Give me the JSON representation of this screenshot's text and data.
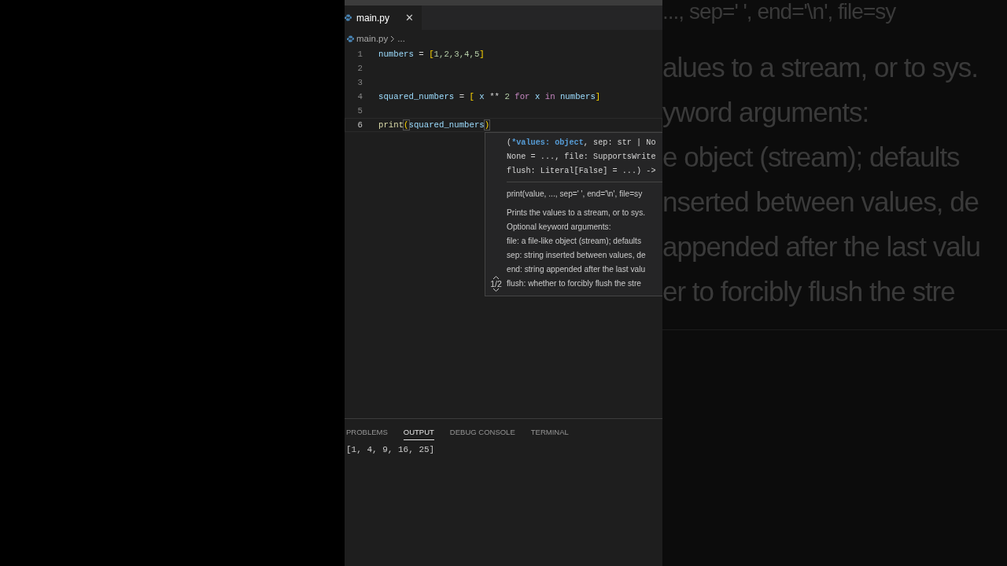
{
  "editor": {
    "tabs": [
      {
        "label": "main.py",
        "selected": true,
        "close": "✕"
      }
    ],
    "breadcrumb": {
      "file": "main.py",
      "rest": "..."
    },
    "lines": [
      {
        "number": "1",
        "current": false,
        "tokens": [
          {
            "kind": "var",
            "text": "numbers"
          },
          {
            "kind": "op",
            "text": " = "
          },
          {
            "kind": "bracket",
            "text": "["
          },
          {
            "kind": "num",
            "text": "1,2,3,4,5"
          },
          {
            "kind": "bracket",
            "text": "]"
          }
        ]
      },
      {
        "number": "2",
        "current": false
      },
      {
        "number": "3",
        "current": false
      },
      {
        "number": "4",
        "current": false,
        "tokens": [
          {
            "kind": "var",
            "text": "squared_numbers"
          },
          {
            "kind": "op",
            "text": " = "
          },
          {
            "kind": "bracket",
            "text": "["
          },
          {
            "kind": "var",
            "text": " x "
          },
          {
            "kind": "op",
            "text": "** "
          },
          {
            "kind": "num",
            "text": "2 "
          },
          {
            "kind": "keyword",
            "text": "for"
          },
          {
            "kind": "var",
            "text": " x "
          },
          {
            "kind": "keyword",
            "text": "in"
          },
          {
            "kind": "var",
            "text": " numbers"
          },
          {
            "kind": "bracket",
            "text": "]"
          }
        ]
      },
      {
        "number": "5",
        "current": false
      },
      {
        "number": "6",
        "current": true,
        "tokens": [
          {
            "kind": "func",
            "text": "print"
          },
          {
            "kind": "paren",
            "text": "("
          },
          {
            "kind": "var",
            "text": "squared_numbers"
          },
          {
            "kind": "paren",
            "text": ")"
          }
        ]
      }
    ]
  },
  "hover": {
    "signature": [
      [
        {
          "kind": "plain",
          "text": "("
        },
        {
          "kind": "param",
          "text": "*values: object"
        },
        {
          "kind": "plain",
          "text": ", sep: str | No"
        }
      ],
      [
        {
          "kind": "plain",
          "text": "None = ..., file: SupportsWrite"
        }
      ],
      [
        {
          "kind": "plain",
          "text": "flush: Literal[False] = ...) ->"
        }
      ]
    ],
    "summary": "print(value, ..., sep=' ', end='\\n', file=sy",
    "doc": [
      "Prints the values to a stream, or to sys.",
      "Optional keyword arguments:",
      "file: a file-like object (stream); defaults",
      "sep: string inserted between values, de",
      "end: string appended after the last valu",
      "flush: whether to forcibly flush the stre"
    ],
    "counter": "1/2"
  },
  "panel": {
    "tabs": [
      {
        "label": "PROBLEMS",
        "selected": false
      },
      {
        "label": "OUTPUT",
        "selected": true
      },
      {
        "label": "DEBUG CONSOLE",
        "selected": false
      },
      {
        "label": "TERMINAL",
        "selected": false
      }
    ],
    "output": "[1, 4, 9, 16, 25]"
  },
  "backdrop": {
    "lines": [
      "..., sep=' ', end='\\n', file=sy",
      "alues to a stream, or to sys.",
      "yword arguments:",
      "e object (stream); defaults",
      "nserted between values, de",
      "appended after the last valu",
      "er to forcibly flush the stre"
    ]
  }
}
